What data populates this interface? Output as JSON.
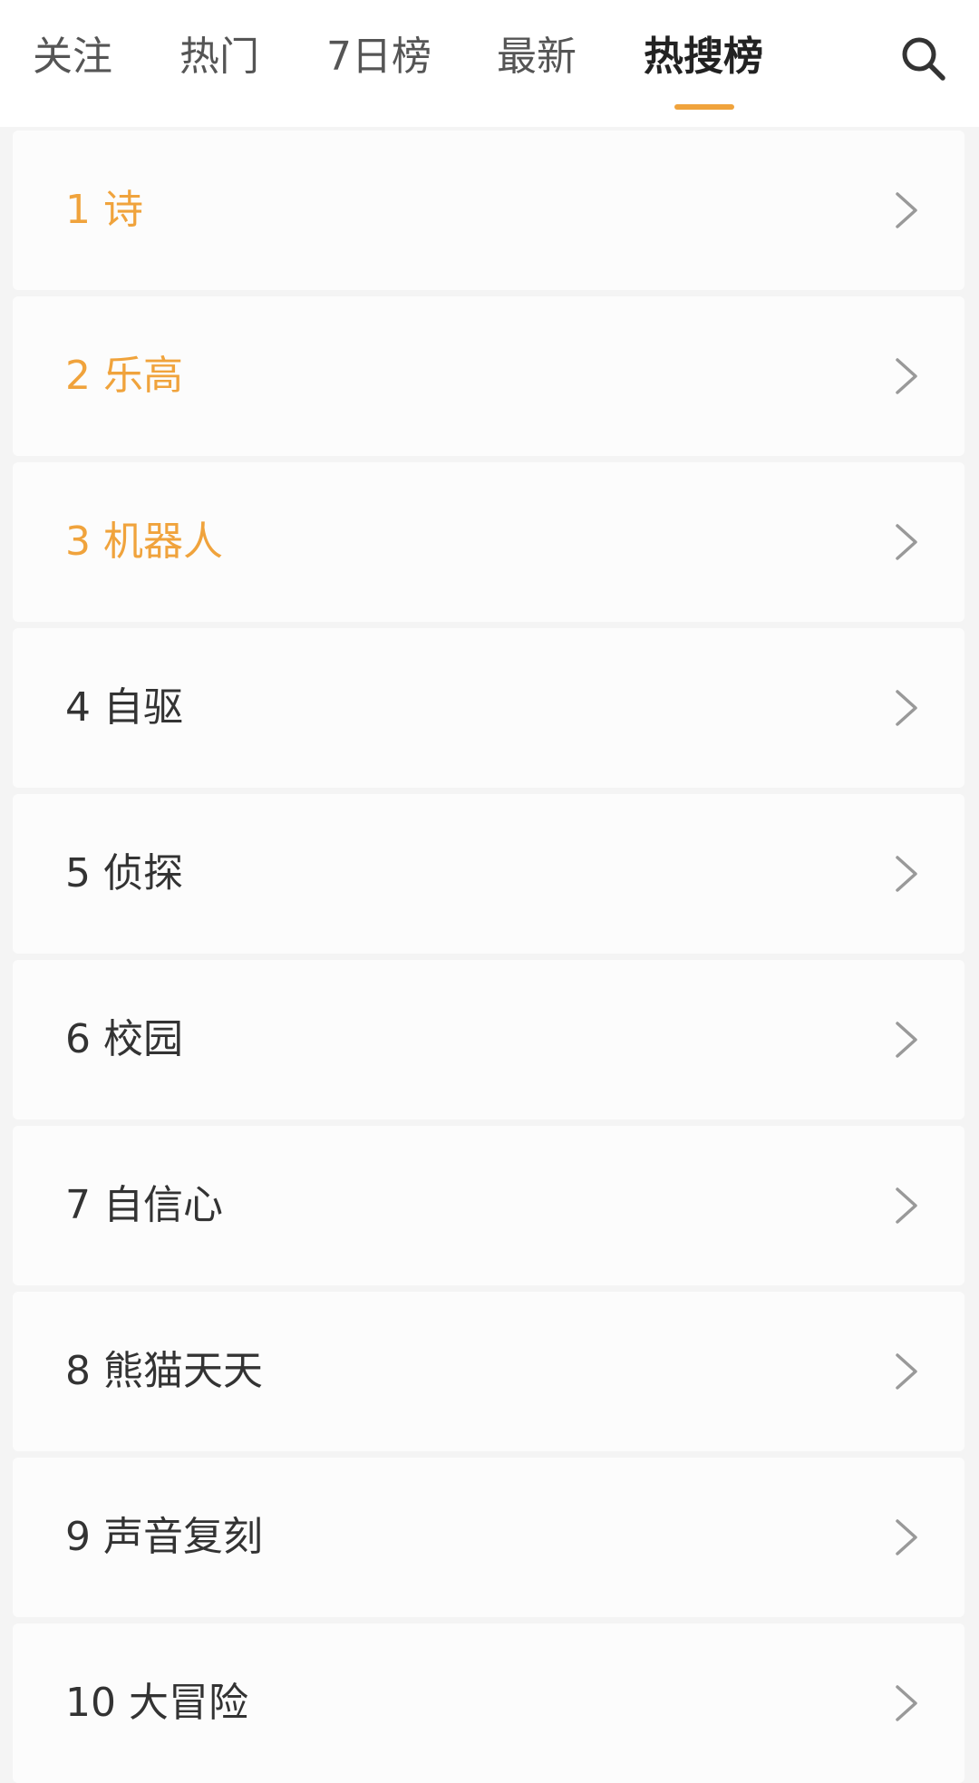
{
  "header": {
    "tabs": [
      {
        "label": "关注",
        "active": false
      },
      {
        "label": "热门",
        "active": false
      },
      {
        "label": "7日榜",
        "active": false
      },
      {
        "label": "最新",
        "active": false
      },
      {
        "label": "热搜榜",
        "active": true
      }
    ],
    "search_icon": "search-icon"
  },
  "colors": {
    "accent": "#f0a33c",
    "text_primary": "#333333",
    "text_tab": "#555555",
    "chevron": "#999999"
  },
  "list": {
    "items": [
      {
        "rank": "1",
        "label": "诗",
        "highlight": true
      },
      {
        "rank": "2",
        "label": "乐高",
        "highlight": true
      },
      {
        "rank": "3",
        "label": "机器人",
        "highlight": true
      },
      {
        "rank": "4",
        "label": "自驱",
        "highlight": false
      },
      {
        "rank": "5",
        "label": "侦探",
        "highlight": false
      },
      {
        "rank": "6",
        "label": "校园",
        "highlight": false
      },
      {
        "rank": "7",
        "label": "自信心",
        "highlight": false
      },
      {
        "rank": "8",
        "label": "熊猫天天",
        "highlight": false
      },
      {
        "rank": "9",
        "label": "声音复刻",
        "highlight": false
      },
      {
        "rank": "10",
        "label": "大冒险",
        "highlight": false
      }
    ]
  }
}
